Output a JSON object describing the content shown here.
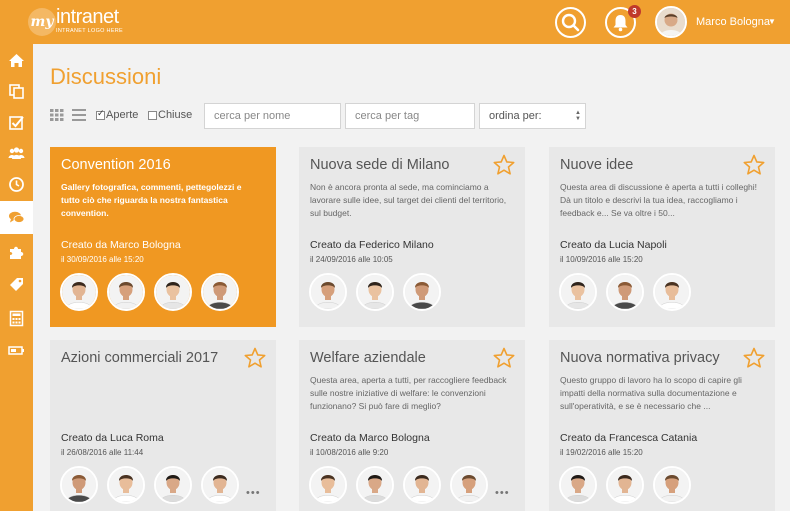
{
  "header": {
    "logo_text": "intranet",
    "logo_mark": "my",
    "logo_subtitle": "INTRANET LOGO HERE",
    "notification_count": "3",
    "user_name": "Marco Bologna",
    "accent_color": "#f0a030"
  },
  "sidebar": {
    "items": [
      {
        "icon": "home-icon"
      },
      {
        "icon": "copy-icon"
      },
      {
        "icon": "checklist-icon"
      },
      {
        "icon": "users-icon"
      },
      {
        "icon": "clock-icon"
      },
      {
        "icon": "chat-icon",
        "active": true
      },
      {
        "icon": "puzzle-icon"
      },
      {
        "icon": "tag-icon"
      },
      {
        "icon": "calculator-icon"
      },
      {
        "icon": "battery-icon"
      }
    ]
  },
  "page": {
    "title": "Discussioni"
  },
  "filters": {
    "open_label": "Aperte",
    "open_checked": true,
    "closed_label": "Chiuse",
    "closed_checked": false,
    "search_name_placeholder": "cerca per nome",
    "search_tag_placeholder": "cerca per tag",
    "sort_label": "ordina per:"
  },
  "cards": [
    {
      "title": "Convention 2016",
      "description": "Gallery fotografica, commenti, pettegolezzi e tutto ciò che riguarda la nostra fantastica convention.",
      "author": "Creato da Marco Bologna",
      "date": "il 30/09/2016 alle 15:20",
      "featured": true,
      "members": 4,
      "more": false
    },
    {
      "title": "Nuova sede di Milano",
      "description": "Non è ancora pronta al sede, ma cominciamo a lavorare sulle idee, sul target dei clienti del territorio, sul budget.",
      "author": "Creato da Federico Milano",
      "date": "il 24/09/2016 alle 10:05",
      "featured": false,
      "members": 3,
      "more": false
    },
    {
      "title": "Nuove idee",
      "description": "Questa area di discussione è aperta a tutti i colleghi! Dà un titolo e descrivi la tua idea, raccogliamo i feedback e... Se va oltre i 50...",
      "author": "Creato da Lucia Napoli",
      "date": "il 10/09/2016 alle 15:20",
      "featured": false,
      "members": 3,
      "more": false
    },
    {
      "title": "Azioni commerciali 2017",
      "description": "",
      "author": "Creato da Luca Roma",
      "date": "il 26/08/2016 alle 11:44",
      "featured": false,
      "members": 4,
      "more": true
    },
    {
      "title": "Welfare aziendale",
      "description": "Questa area, aperta a tutti, per raccogliere feedback sulle nostre iniziative di welfare: le convenzioni funzionano? Si può fare di meglio?",
      "author": "Creato da Marco Bologna",
      "date": "il 10/08/2016 alle 9:20",
      "featured": false,
      "members": 4,
      "more": true
    },
    {
      "title": "Nuova normativa privacy",
      "description": "Questo gruppo di lavoro ha lo scopo di capire gli impatti della normativa sulla documentazione e sull'operatività, e se è necessario che ...",
      "author": "Creato da Francesca Catania",
      "date": "il 19/02/2016 alle 15:20",
      "featured": false,
      "members": 3,
      "more": false
    }
  ]
}
